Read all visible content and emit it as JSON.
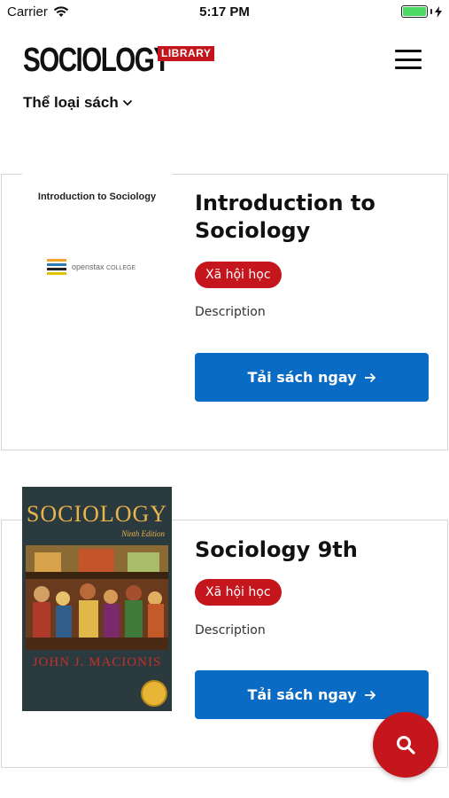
{
  "status_bar": {
    "carrier": "Carrier",
    "time": "5:17 PM"
  },
  "header": {
    "logo_main": "SOCIOLOGY",
    "logo_badge": "LIBRARY",
    "category_label": "Thể loại sách"
  },
  "books": [
    {
      "title": "Introduction to Sociology",
      "tag": "Xã hội học",
      "description": "Description",
      "button_label": "Tải sách ngay",
      "cover_title": "Introduction to Sociology",
      "cover_publisher_a": "openstax",
      "cover_publisher_b": "COLLEGE"
    },
    {
      "title": "Sociology 9th",
      "tag": "Xã hội học",
      "description": "Description",
      "button_label": "Tải sách ngay",
      "cover_title": "SOCIOLOGY",
      "cover_edition": "Ninth Edition",
      "cover_author": "JOHN J. MACIONIS"
    }
  ],
  "colors": {
    "brand_red": "#c4161c",
    "button_blue": "#0a6bc4"
  },
  "icons": {
    "wifi": "wifi-icon",
    "battery": "battery-icon",
    "charging": "charging-icon",
    "menu": "hamburger-menu-icon",
    "chevron": "chevron-down-icon",
    "arrow": "arrow-right-icon",
    "search": "search-icon"
  }
}
